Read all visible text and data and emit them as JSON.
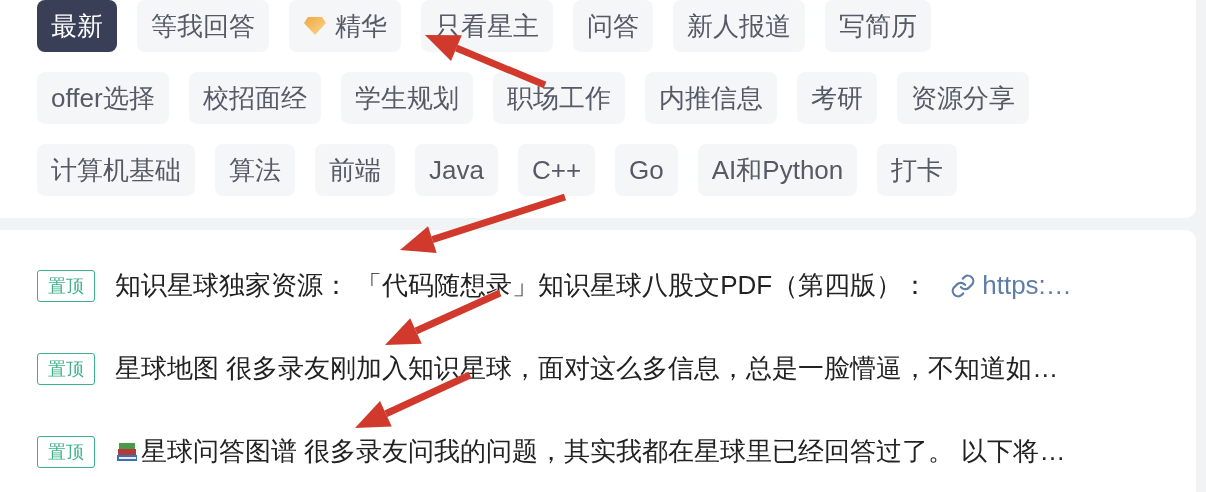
{
  "tag_rows": [
    [
      {
        "label": "最新",
        "selected": true
      },
      {
        "label": "等我回答",
        "selected": false
      },
      {
        "label": "精华",
        "selected": false,
        "kind": "featured"
      },
      {
        "label": "只看星主",
        "selected": false
      },
      {
        "label": "问答",
        "selected": false
      },
      {
        "label": "新人报道",
        "selected": false
      },
      {
        "label": "写简历",
        "selected": false
      }
    ],
    [
      {
        "label": "offer选择",
        "selected": false
      },
      {
        "label": "校招面经",
        "selected": false
      },
      {
        "label": "学生规划",
        "selected": false
      },
      {
        "label": "职场工作",
        "selected": false
      },
      {
        "label": "内推信息",
        "selected": false
      },
      {
        "label": "考研",
        "selected": false
      },
      {
        "label": "资源分享",
        "selected": false
      }
    ],
    [
      {
        "label": "计算机基础",
        "selected": false
      },
      {
        "label": "算法",
        "selected": false
      },
      {
        "label": "前端",
        "selected": false
      },
      {
        "label": "Java",
        "selected": false
      },
      {
        "label": "C++",
        "selected": false
      },
      {
        "label": "Go",
        "selected": false
      },
      {
        "label": "AI和Python",
        "selected": false
      },
      {
        "label": "打卡",
        "selected": false
      }
    ]
  ],
  "pinned_posts": [
    {
      "badge": "置顶",
      "text": "知识星球独家资源： 「代码随想录」知识星球八股文PDF（第四版）：",
      "link": "https:…"
    },
    {
      "badge": "置顶",
      "text": "星球地图 很多录友刚加入知识星球，面对这么多信息，总是一脸懵逼，不知道如…"
    },
    {
      "badge": "置顶",
      "kind": "reading-list",
      "text": "星球问答图谱 很多录友问我的问题，其实我都在星球里已经回答过了。 以下将…"
    }
  ]
}
